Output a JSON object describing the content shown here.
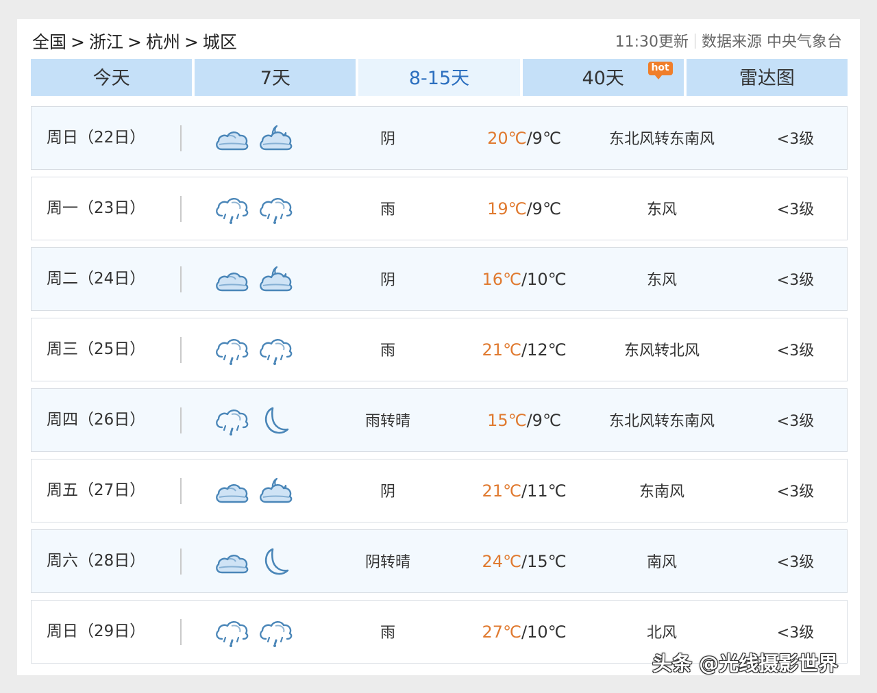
{
  "breadcrumb": {
    "items": [
      "全国",
      "浙江",
      "杭州",
      "城区"
    ],
    "separator": ">"
  },
  "meta": {
    "update_time": "11:30更新",
    "source": "数据来源 中央气象台"
  },
  "tabs": [
    {
      "label": "今天",
      "active": false
    },
    {
      "label": "7天",
      "active": false
    },
    {
      "label": "8-15天",
      "active": true
    },
    {
      "label": "40天",
      "active": false,
      "badge": "hot"
    },
    {
      "label": "雷达图",
      "active": false
    }
  ],
  "colors": {
    "tab_bg": "#c5e0f8",
    "tab_active_bg": "#e9f4fd",
    "tab_active_text": "#2c6fbf",
    "high_temp": "#e07a30",
    "icon_stroke": "#4a86b8",
    "icon_fill": "#cfe3f5",
    "badge": "#f07e2a"
  },
  "forecast": [
    {
      "day": "周日（22日）",
      "icon_day": "overcast-icon",
      "icon_night": "cloudy-moon-icon",
      "condition": "阴",
      "high": "20℃",
      "low": "9℃",
      "wind": "东北风转东南风",
      "level": "<3级"
    },
    {
      "day": "周一（23日）",
      "icon_day": "rain-icon",
      "icon_night": "rain-icon",
      "condition": "雨",
      "high": "19℃",
      "low": "9℃",
      "wind": "东风",
      "level": "<3级"
    },
    {
      "day": "周二（24日）",
      "icon_day": "overcast-icon",
      "icon_night": "cloudy-moon-icon",
      "condition": "阴",
      "high": "16℃",
      "low": "10℃",
      "wind": "东风",
      "level": "<3级"
    },
    {
      "day": "周三（25日）",
      "icon_day": "rain-icon",
      "icon_night": "rain-icon",
      "condition": "雨",
      "high": "21℃",
      "low": "12℃",
      "wind": "东风转北风",
      "level": "<3级"
    },
    {
      "day": "周四（26日）",
      "icon_day": "rain-icon",
      "icon_night": "moon-icon",
      "condition": "雨转晴",
      "high": "15℃",
      "low": "9℃",
      "wind": "东北风转东南风",
      "level": "<3级"
    },
    {
      "day": "周五（27日）",
      "icon_day": "overcast-icon",
      "icon_night": "cloudy-moon-icon",
      "condition": "阴",
      "high": "21℃",
      "low": "11℃",
      "wind": "东南风",
      "level": "<3级"
    },
    {
      "day": "周六（28日）",
      "icon_day": "overcast-icon",
      "icon_night": "moon-icon",
      "condition": "阴转晴",
      "high": "24℃",
      "low": "15℃",
      "wind": "南风",
      "level": "<3级"
    },
    {
      "day": "周日（29日）",
      "icon_day": "rain-icon",
      "icon_night": "rain-icon",
      "condition": "雨",
      "high": "27℃",
      "low": "10℃",
      "wind": "北风",
      "level": "<3级"
    }
  ],
  "watermark": "头条 @光线摄影世界"
}
